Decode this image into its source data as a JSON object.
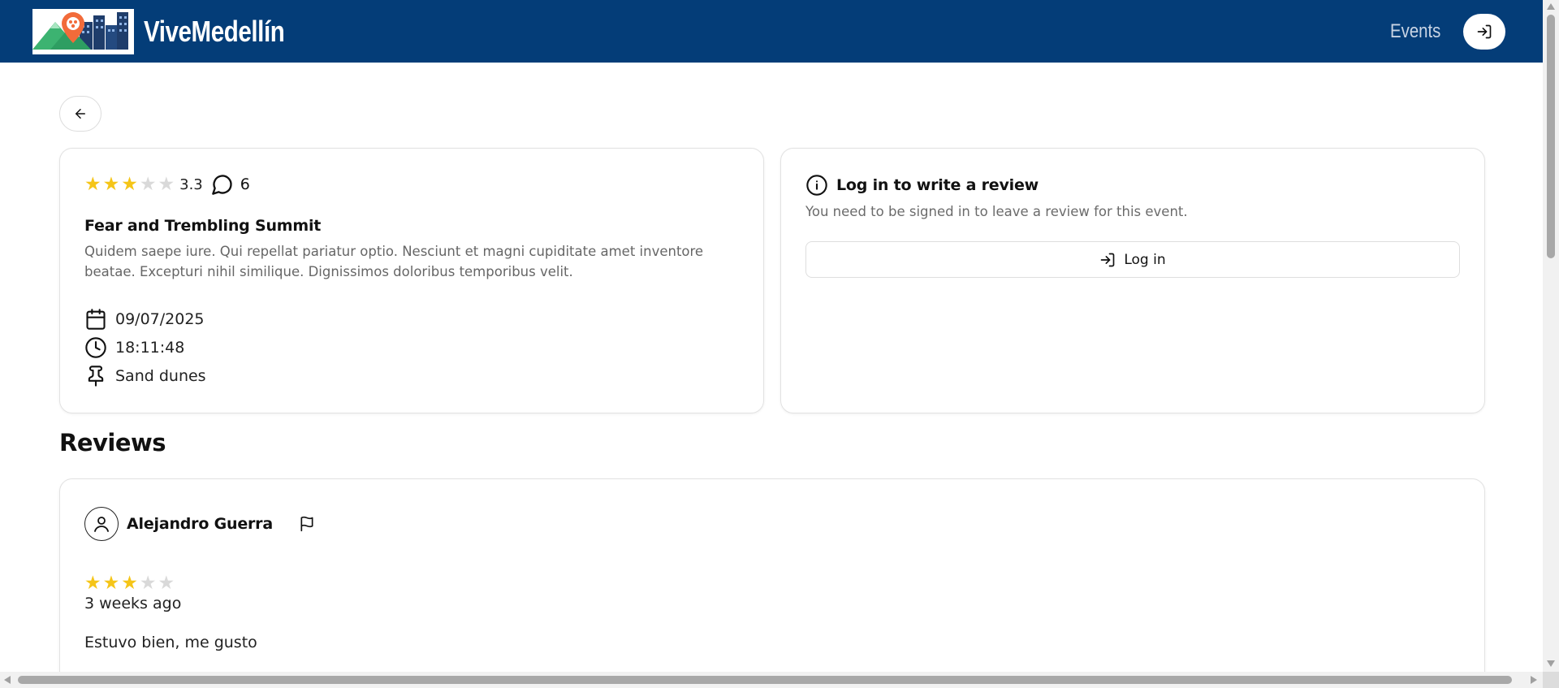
{
  "header": {
    "brand": "ViveMedellín",
    "nav_events": "Events",
    "login_icon": "login-icon",
    "logo_icon": "city-mountains-logo"
  },
  "colors": {
    "header_bg": "#043d78",
    "star_on": "#f5c518",
    "star_off": "#d9d9d9"
  },
  "back_button": {
    "icon": "arrow-left-icon"
  },
  "event": {
    "rating": 3.3,
    "rating_label": "3.3",
    "stars_filled": 3,
    "stars_total": 5,
    "comment_count": "6",
    "title": "Fear and Trembling Summit",
    "description": "Quidem saepe iure. Qui repellat pariatur optio. Nesciunt et magni cupiditate amet inventore beatae. Excepturi nihil similique. Dignissimos doloribus temporibus velit.",
    "date": "09/07/2025",
    "time": "18:11:48",
    "location": "Sand dunes"
  },
  "login_prompt": {
    "title": "Log in to write a review",
    "subtitle": "You need to be signed in to leave a review for this event.",
    "button_label": "Log in"
  },
  "reviews": {
    "heading": "Reviews",
    "items": [
      {
        "author": "Alejandro Guerra",
        "stars_filled": 3,
        "stars_total": 5,
        "time_ago": "3 weeks ago",
        "text": "Estuvo bien, me gusto"
      }
    ]
  }
}
